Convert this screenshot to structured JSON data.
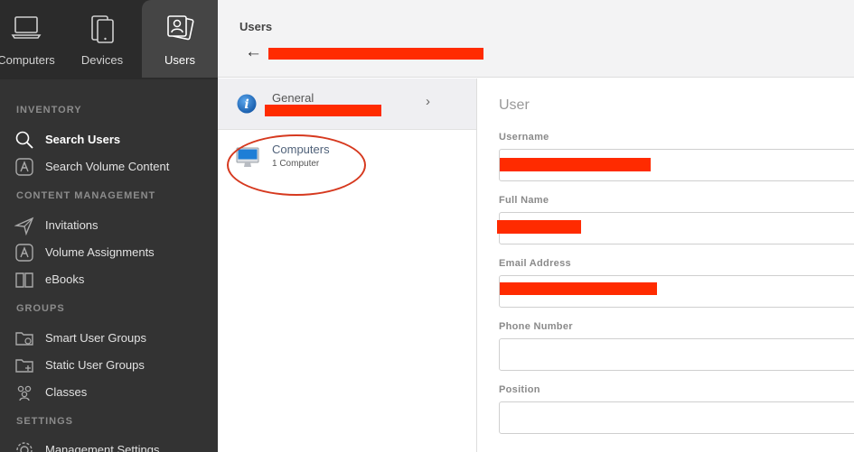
{
  "sidebar": {
    "topnav": [
      {
        "label": "Computers",
        "icon": "laptop-icon"
      },
      {
        "label": "Devices",
        "icon": "mobile-device-icon"
      },
      {
        "label": "Users",
        "icon": "user-card-icon"
      }
    ],
    "sections": [
      {
        "heading": "INVENTORY",
        "items": [
          {
            "label": "Search Users",
            "icon": "search-icon",
            "active": true
          },
          {
            "label": "Search Volume Content",
            "icon": "app-store-icon"
          }
        ]
      },
      {
        "heading": "CONTENT MANAGEMENT",
        "items": [
          {
            "label": "Invitations",
            "icon": "paper-plane-icon"
          },
          {
            "label": "Volume Assignments",
            "icon": "app-store-icon"
          },
          {
            "label": "eBooks",
            "icon": "book-icon"
          }
        ]
      },
      {
        "heading": "GROUPS",
        "items": [
          {
            "label": "Smart User Groups",
            "icon": "smart-folder-icon"
          },
          {
            "label": "Static User Groups",
            "icon": "folder-plus-icon"
          },
          {
            "label": "Classes",
            "icon": "people-icon"
          }
        ]
      },
      {
        "heading": "SETTINGS",
        "items": [
          {
            "label": "Management Settings",
            "icon": "gear-icon"
          }
        ]
      }
    ]
  },
  "header": {
    "title": "Users",
    "back_icon": "back-arrow-icon"
  },
  "list": [
    {
      "title": "General",
      "icon": "info-icon"
    },
    {
      "title": "Computers",
      "subtitle": "1 Computer",
      "icon": "imac-icon"
    }
  ],
  "detail": {
    "section_title": "User",
    "fields": [
      {
        "label": "Username",
        "value": ""
      },
      {
        "label": "Full Name",
        "value": ""
      },
      {
        "label": "Email Address",
        "value": ""
      },
      {
        "label": "Phone Number",
        "value": ""
      },
      {
        "label": "Position",
        "value": ""
      }
    ]
  },
  "colors": {
    "sidebar": "#333333",
    "accent": "#1f6fc0",
    "redaction": "#ff2b00",
    "annotation": "#d6391f"
  }
}
